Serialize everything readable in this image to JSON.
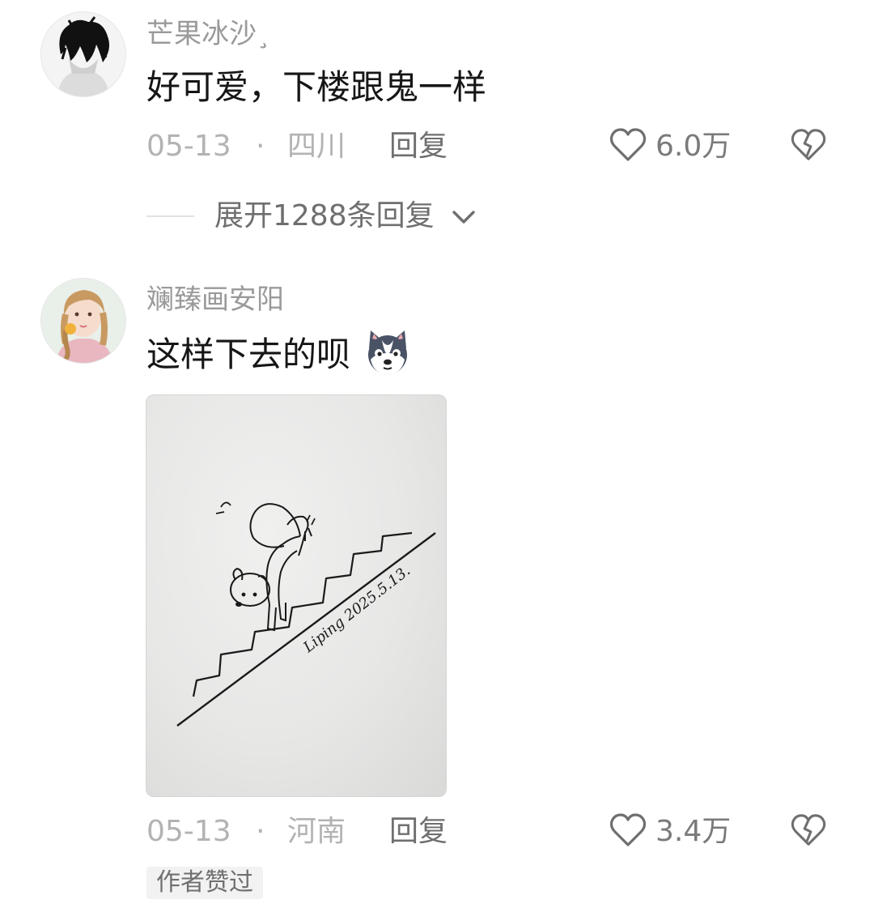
{
  "comments": [
    {
      "username": "芒果冰沙¸",
      "content": "好可爱，下楼跟鬼一样",
      "date": "05-13",
      "separator": "·",
      "location": "四川",
      "reply_label": "回复",
      "likes": "6.0万",
      "expand_replies": "展开1288条回复"
    },
    {
      "username": "斓臻画安阳",
      "content": "这样下去的呗",
      "date": "05-13",
      "separator": "·",
      "location": "河南",
      "reply_label": "回复",
      "likes": "3.4万",
      "author_liked_tag": "作者赞过",
      "image_signature": "Liping 2025.5.13."
    }
  ],
  "icons": {
    "like": "heart-outline-icon",
    "dislike": "broken-heart-icon",
    "expand": "chevron-down-icon",
    "emoji": "husky-dog-emoji-icon"
  },
  "colors": {
    "username": "#9a9a9a",
    "content": "#161616",
    "meta": "#b3b3b3",
    "action": "#6f6f6f"
  }
}
